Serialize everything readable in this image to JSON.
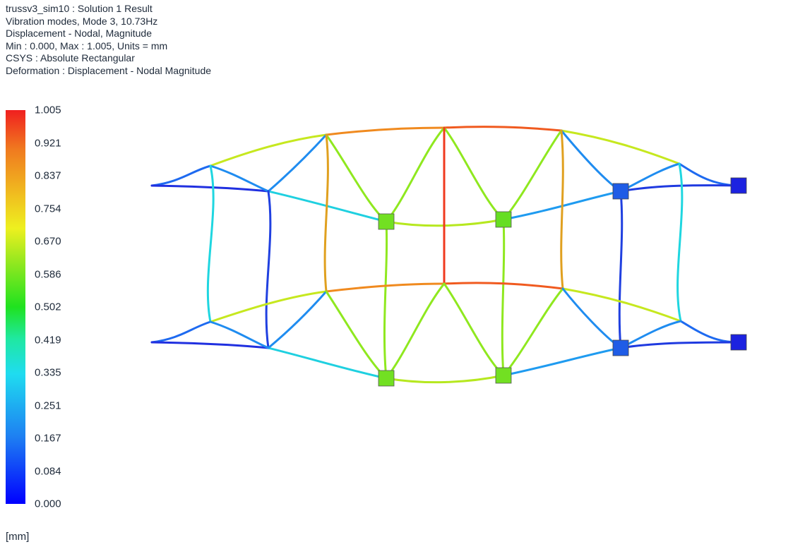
{
  "header": {
    "lines": [
      "trussv3_sim10 : Solution 1 Result",
      "Vibration modes, Mode 3, 10.73Hz",
      "Displacement - Nodal, Magnitude",
      "Min : 0.000, Max : 1.005, Units = mm",
      "CSYS : Absolute Rectangular",
      "Deformation : Displacement - Nodal Magnitude"
    ]
  },
  "legend": {
    "ticks": [
      "1.005",
      "0.921",
      "0.837",
      "0.754",
      "0.670",
      "0.586",
      "0.502",
      "0.419",
      "0.335",
      "0.251",
      "0.167",
      "0.084",
      "0.000"
    ],
    "units": "[mm]",
    "min": 0.0,
    "max": 1.005,
    "colors": [
      "#0000ff",
      "#1a5cf0",
      "#1e9bf0",
      "#1fd6f0",
      "#1ff0b0",
      "#1fe83c",
      "#7ce81f",
      "#e0f01f",
      "#f0c01f",
      "#f08c1f",
      "#f05a1f",
      "#f0201f"
    ]
  },
  "markers": {
    "constrained_color": "#1c1ce0",
    "blue_color": "#1f5ce6",
    "green_color": "#6fe020"
  }
}
